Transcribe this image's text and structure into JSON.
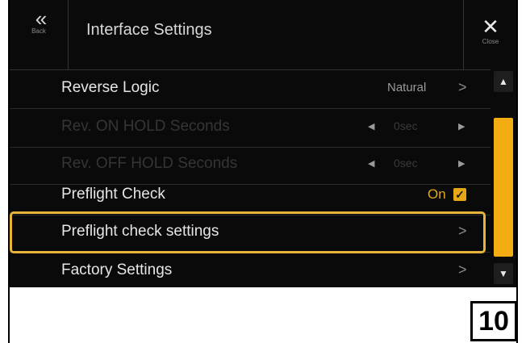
{
  "header": {
    "back_glyph": "«",
    "back_label": "Back",
    "title": "Interface Settings",
    "close_glyph": "✕",
    "close_label": "Close"
  },
  "rows": [
    {
      "label": "Reverse Logic",
      "value": "Natural",
      "chevron": ">"
    },
    {
      "label": "Rev. ON HOLD Seconds",
      "value": "0sec",
      "left_arrow": "◀",
      "right_arrow": "▶",
      "disabled": true
    },
    {
      "label": "Rev. OFF HOLD Seconds",
      "value": "0sec",
      "left_arrow": "◀",
      "right_arrow": "▶",
      "disabled": true
    },
    {
      "label": "Preflight Check",
      "value": "On",
      "checkbox": "✓",
      "checked": true
    },
    {
      "label": "Preflight check settings",
      "chevron": ">",
      "selected": true
    },
    {
      "label": "Factory Settings",
      "chevron": ">"
    }
  ],
  "scrollbar": {
    "up_glyph": "▲",
    "down_glyph": "▼"
  },
  "page_number": "10",
  "colors": {
    "accent": "#e7b33b",
    "thumb": "#f2ad12",
    "background": "#0a0a0a"
  }
}
